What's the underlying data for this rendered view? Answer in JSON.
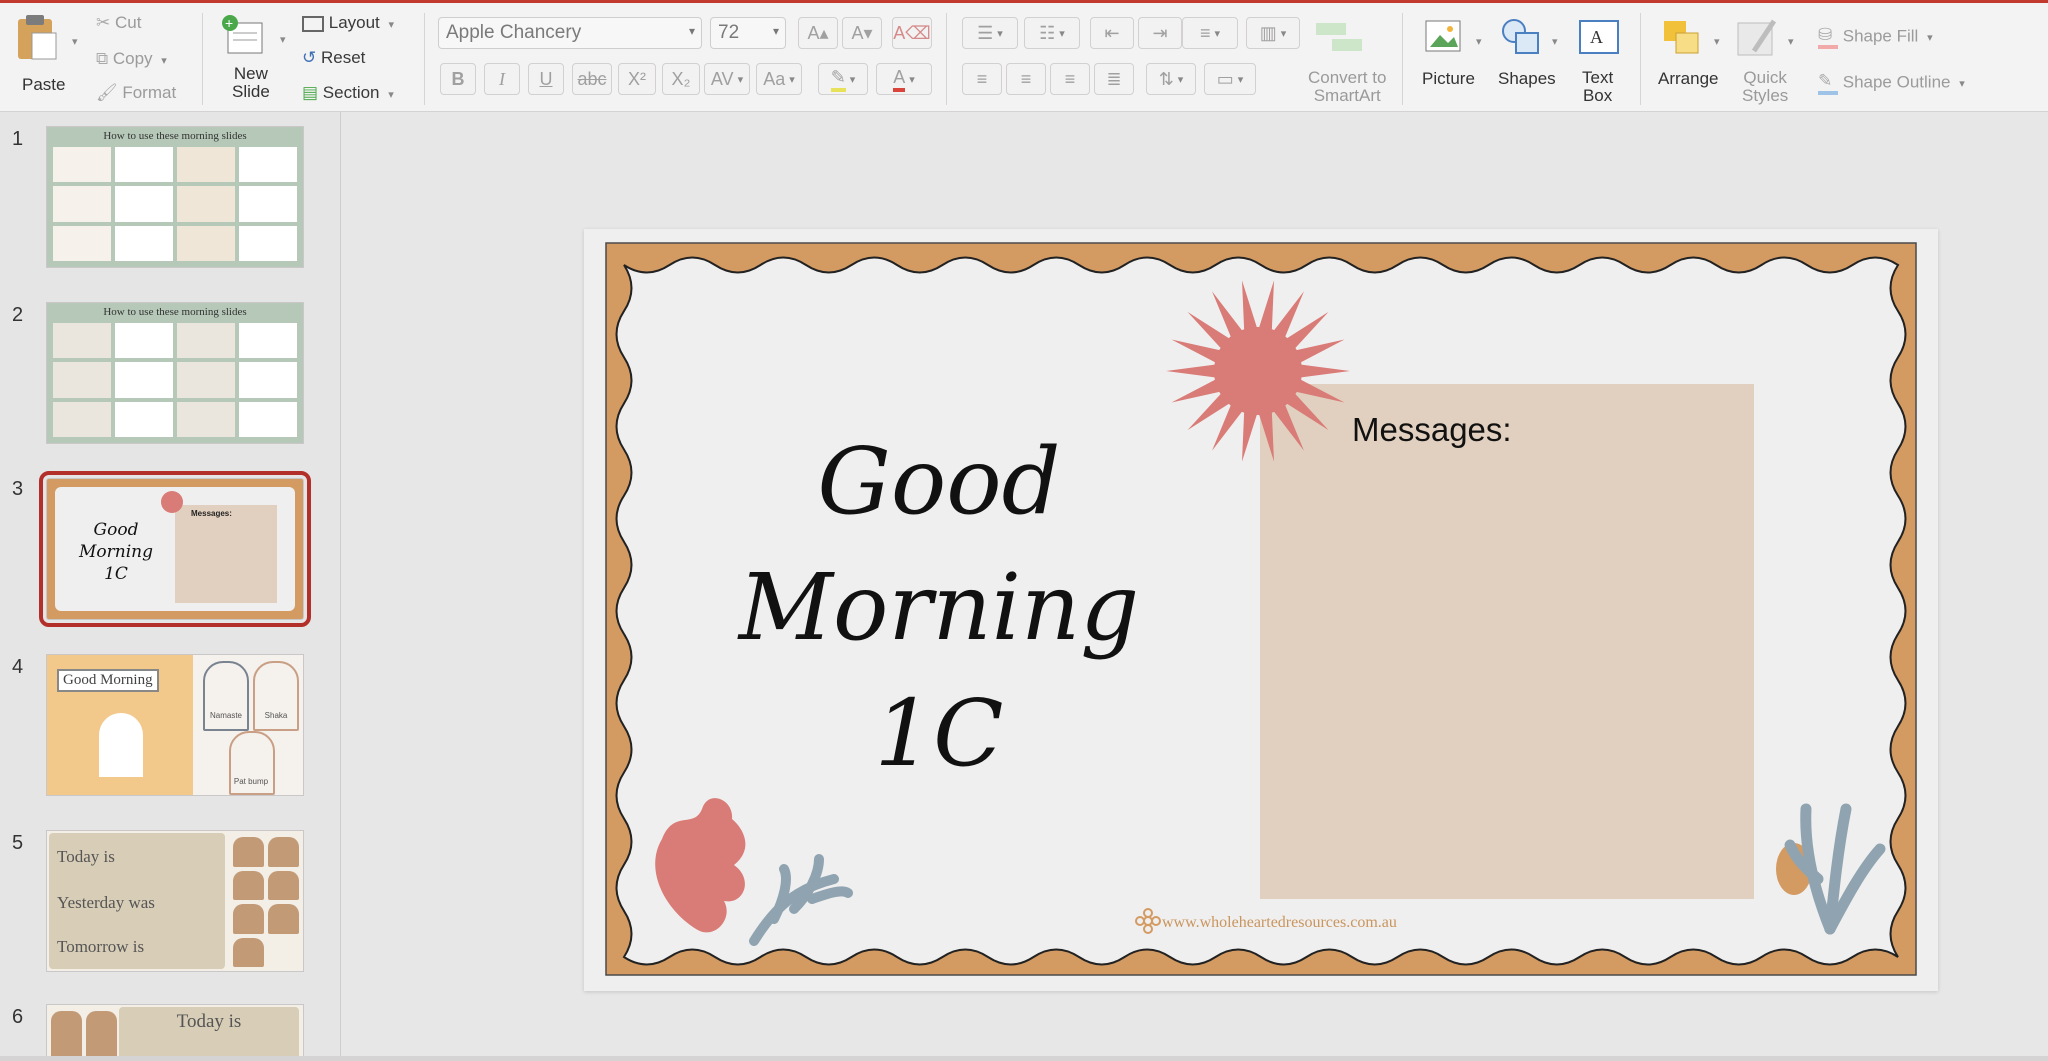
{
  "ribbon": {
    "clipboard": {
      "paste": "Paste",
      "cut": "Cut",
      "copy": "Copy",
      "format": "Format"
    },
    "slides": {
      "new_slide": "New\nSlide",
      "layout": "Layout",
      "reset": "Reset",
      "section": "Section"
    },
    "font": {
      "family": "Apple Chancery",
      "size": "72"
    },
    "convert": "Convert to\nSmartArt",
    "picture": "Picture",
    "shapes": "Shapes",
    "text_box": "Text\nBox",
    "arrange": "Arrange",
    "quick_styles": "Quick\nStyles",
    "shape_fill": "Shape Fill",
    "shape_outline": "Shape Outline"
  },
  "slides_panel": {
    "items": [
      {
        "number": "1",
        "heading": "How to use these morning slides"
      },
      {
        "number": "2",
        "heading": "How to use these morning slides"
      },
      {
        "number": "3",
        "heading": "Good Morning 1C",
        "messages": "Messages:"
      },
      {
        "number": "4",
        "heading": "Good Morning",
        "cards": [
          "Namaste",
          "Shaka",
          "Pat bump"
        ]
      },
      {
        "number": "5",
        "lines": [
          "Today is",
          "Yesterday was",
          "Tomorrow is"
        ]
      },
      {
        "number": "6",
        "heading": "Today is"
      }
    ]
  },
  "slide": {
    "title_lines": [
      "Good",
      "Morning",
      "1C"
    ],
    "messages_label": "Messages:",
    "website": "www.wholeheartedresources.com.au"
  },
  "colors": {
    "accent": "#c23a2e",
    "border_orange": "#d39b62",
    "message_box": "#e1d0bf",
    "sun": "#d97b76",
    "sage": "#b7c7b6",
    "blue_leaf": "#8fa4b0"
  }
}
